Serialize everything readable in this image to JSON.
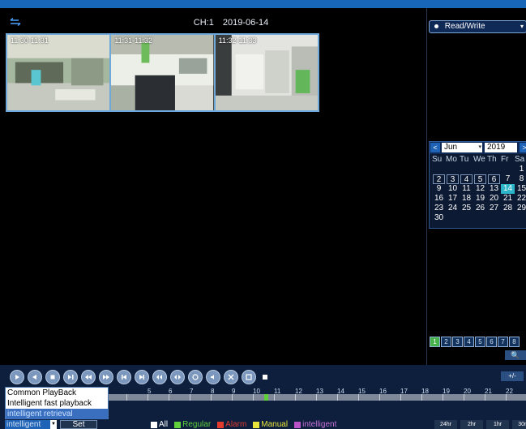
{
  "header": {
    "channel": "CH:1",
    "date": "2019-06-14"
  },
  "thumbnails": [
    {
      "time": "11:30-11:31"
    },
    {
      "time": "11:31-11:32"
    },
    {
      "time": "11:32-11:33"
    }
  ],
  "right_panel": {
    "mode_select": "Read/Write",
    "calendar": {
      "month": "Jun",
      "year": "2019",
      "weekdays": [
        "Su",
        "Mo",
        "Tu",
        "We",
        "Th",
        "Fr",
        "Sa"
      ],
      "days": [
        "",
        "",
        "",
        "",
        "",
        "",
        "1",
        "2",
        "3",
        "4",
        "5",
        "6",
        "7",
        "8",
        "9",
        "10",
        "11",
        "12",
        "13",
        "14",
        "15",
        "16",
        "17",
        "18",
        "19",
        "20",
        "21",
        "22",
        "23",
        "24",
        "25",
        "26",
        "27",
        "28",
        "29",
        "30",
        "",
        "",
        "",
        "",
        "",
        ""
      ],
      "selected_day": "14"
    },
    "channels": [
      "1",
      "2",
      "3",
      "4",
      "5",
      "6",
      "7",
      "8"
    ],
    "active_channel": "1"
  },
  "controls": {
    "buttons": [
      "play",
      "rewind",
      "stop",
      "step-forward",
      "fast-backward",
      "fast-forward",
      "prev",
      "next",
      "backup",
      "snapshot",
      "zoom",
      "audio",
      "fullscreen",
      "clip"
    ],
    "zoom_label": "+/-"
  },
  "timeline": {
    "hours": [
      "5",
      "6",
      "7",
      "8",
      "9",
      "10",
      "11",
      "12",
      "13",
      "14",
      "15",
      "16",
      "17",
      "18",
      "19",
      "20",
      "21",
      "22",
      "23"
    ]
  },
  "playback_mode": {
    "options": [
      "Common PlayBack",
      "Intelligent fast playback",
      "intelligent retrieval"
    ],
    "selected": "intelligent retrieval",
    "current": "intelligent",
    "set_label": "Set"
  },
  "legend": {
    "all": "All",
    "regular": "Regular",
    "alarm": "Alarm",
    "manual": "Manual",
    "intelligent": "intelligent"
  },
  "time_ranges": [
    "24hr",
    "2hr",
    "1hr",
    "30m"
  ],
  "colors": {
    "accent": "#1766b8",
    "regular": "#5fcf3a",
    "alarm": "#e23b2e",
    "manual": "#e9e43b",
    "intelligent": "#b651c6",
    "selected_day": "#2cb5c8"
  }
}
